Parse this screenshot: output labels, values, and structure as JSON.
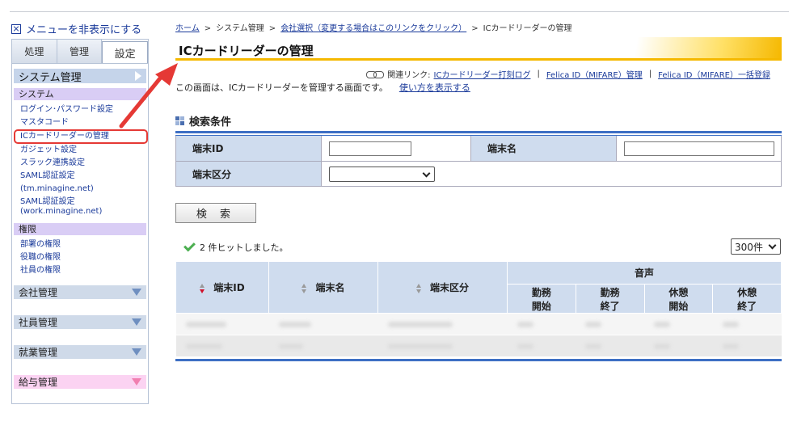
{
  "sidebar": {
    "toggle_label": "メニューを非表示にする",
    "tabs": [
      "処理",
      "管理",
      "設定"
    ],
    "section_header": "システム管理",
    "system_subhead": "システム",
    "system_items": [
      "ログイン･パスワード設定",
      "マスタコード",
      "ICカードリーダーの管理",
      "ガジェット設定",
      "スラック連携設定",
      "SAML認証設定(tm.minagine.net)",
      "SAML認証設定",
      "(work.minagine.net)"
    ],
    "perm_subhead": "権限",
    "perm_items": [
      "部署の権限",
      "役職の権限",
      "社員の権限"
    ],
    "groups": [
      "会社管理",
      "社員管理",
      "就業管理",
      "給与管理"
    ]
  },
  "breadcrumb": {
    "home": "ホーム",
    "sys": "システム管理",
    "company": "会社選択（変更する場合はこのリンクをクリック）",
    "current": "ICカードリーダーの管理",
    "sep": ">"
  },
  "page_title": "ICカードリーダーの管理",
  "related": {
    "label": "関連リンク:",
    "links": [
      "ICカードリーダー打刻ログ",
      "Felica ID（MIFARE）管理",
      "Felica ID（MIFARE）一括登録"
    ],
    "sep": "|"
  },
  "description": "この画面は、ICカードリーダーを管理する画面です。",
  "howto_link": "使い方を表示する",
  "search": {
    "heading": "検索条件",
    "terminal_id_label": "端末ID",
    "terminal_name_label": "端末名",
    "terminal_type_label": "端末区分",
    "button_label": "検 索"
  },
  "results": {
    "hits_text": "2 件ヒットしました。",
    "per_page": "300件",
    "columns": {
      "id": "端末ID",
      "name": "端末名",
      "type": "端末区分",
      "voice": "音声",
      "voice_sub": [
        "勤務開始",
        "勤務終了",
        "休憩開始",
        "休憩終了"
      ]
    },
    "voice_sub_lines": [
      [
        "勤務",
        "開始"
      ],
      [
        "勤務",
        "終了"
      ],
      [
        "休憩",
        "開始"
      ],
      [
        "休憩",
        "終了"
      ]
    ]
  },
  "colors": {
    "accent_blue": "#3d6fc4",
    "header_bg": "#cfdcee",
    "title_underline": "#f5b800",
    "annotation_red": "#e53935"
  }
}
